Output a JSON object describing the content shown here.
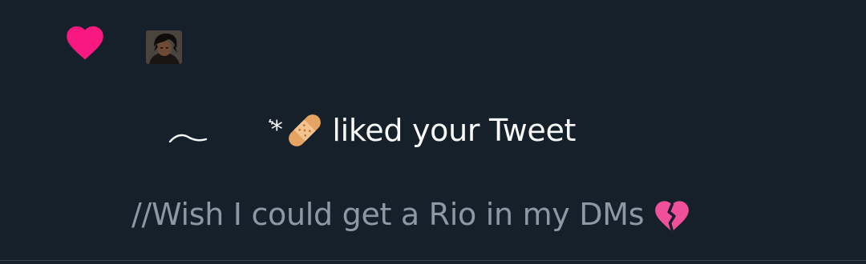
{
  "notification": {
    "type_icon": "heart-icon",
    "avatar_icon": "avatar",
    "user_name_glyphs": "͛*",
    "user_name_emoji": "bandage-icon",
    "action_text": "liked your Tweet",
    "tweet_text": "//Wish I could get a Rio in my DMs",
    "tweet_emoji": "broken-heart-icon"
  },
  "colors": {
    "background": "#15202b",
    "like_pink": "#f91880",
    "primary_text": "#f7f9f9",
    "secondary_text": "#8b98a5",
    "divider": "#38444d"
  }
}
